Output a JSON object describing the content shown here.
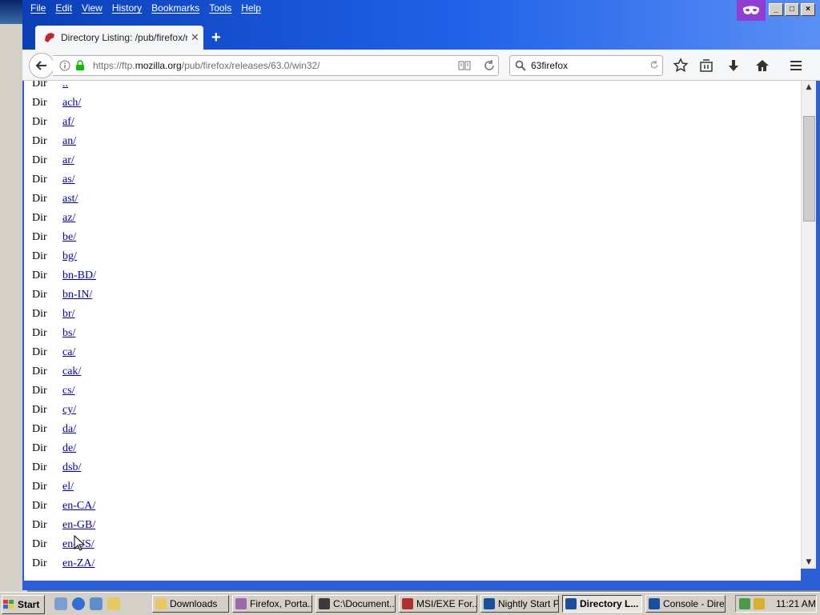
{
  "menu": [
    "File",
    "Edit",
    "View",
    "History",
    "Bookmarks",
    "Tools",
    "Help"
  ],
  "tab": {
    "title": "Directory Listing: /pub/firefox/r..."
  },
  "urlbar": {
    "scheme": "https://ftp.",
    "host": "mozilla.org",
    "path": "/pub/firefox/releases/63.0/win32/"
  },
  "search": {
    "query": "63firefox"
  },
  "listing": {
    "kind_label": "Dir",
    "entries": [
      "..",
      "ach/",
      "af/",
      "an/",
      "ar/",
      "as/",
      "ast/",
      "az/",
      "be/",
      "bg/",
      "bn-BD/",
      "bn-IN/",
      "br/",
      "bs/",
      "ca/",
      "cak/",
      "cs/",
      "cy/",
      "da/",
      "de/",
      "dsb/",
      "el/",
      "en-CA/",
      "en-GB/",
      "en-US/",
      "en-ZA/"
    ]
  },
  "taskbar": {
    "start_label": "Start",
    "tasks": [
      {
        "label": "Downloads",
        "active": false
      },
      {
        "label": "Firefox, Porta...",
        "active": false
      },
      {
        "label": "C:\\Document...",
        "active": false
      },
      {
        "label": "MSI/EXE For...",
        "active": false
      },
      {
        "label": "Nightly Start P...",
        "active": false
      },
      {
        "label": "Directory L...",
        "active": true
      },
      {
        "label": "Console - Dire...",
        "active": false
      }
    ],
    "clock": "11:21 AM"
  },
  "colors": {
    "titlebar_start": "#0b3fb8",
    "private_badge": "#8e3fd1",
    "link": "#0000aa"
  }
}
